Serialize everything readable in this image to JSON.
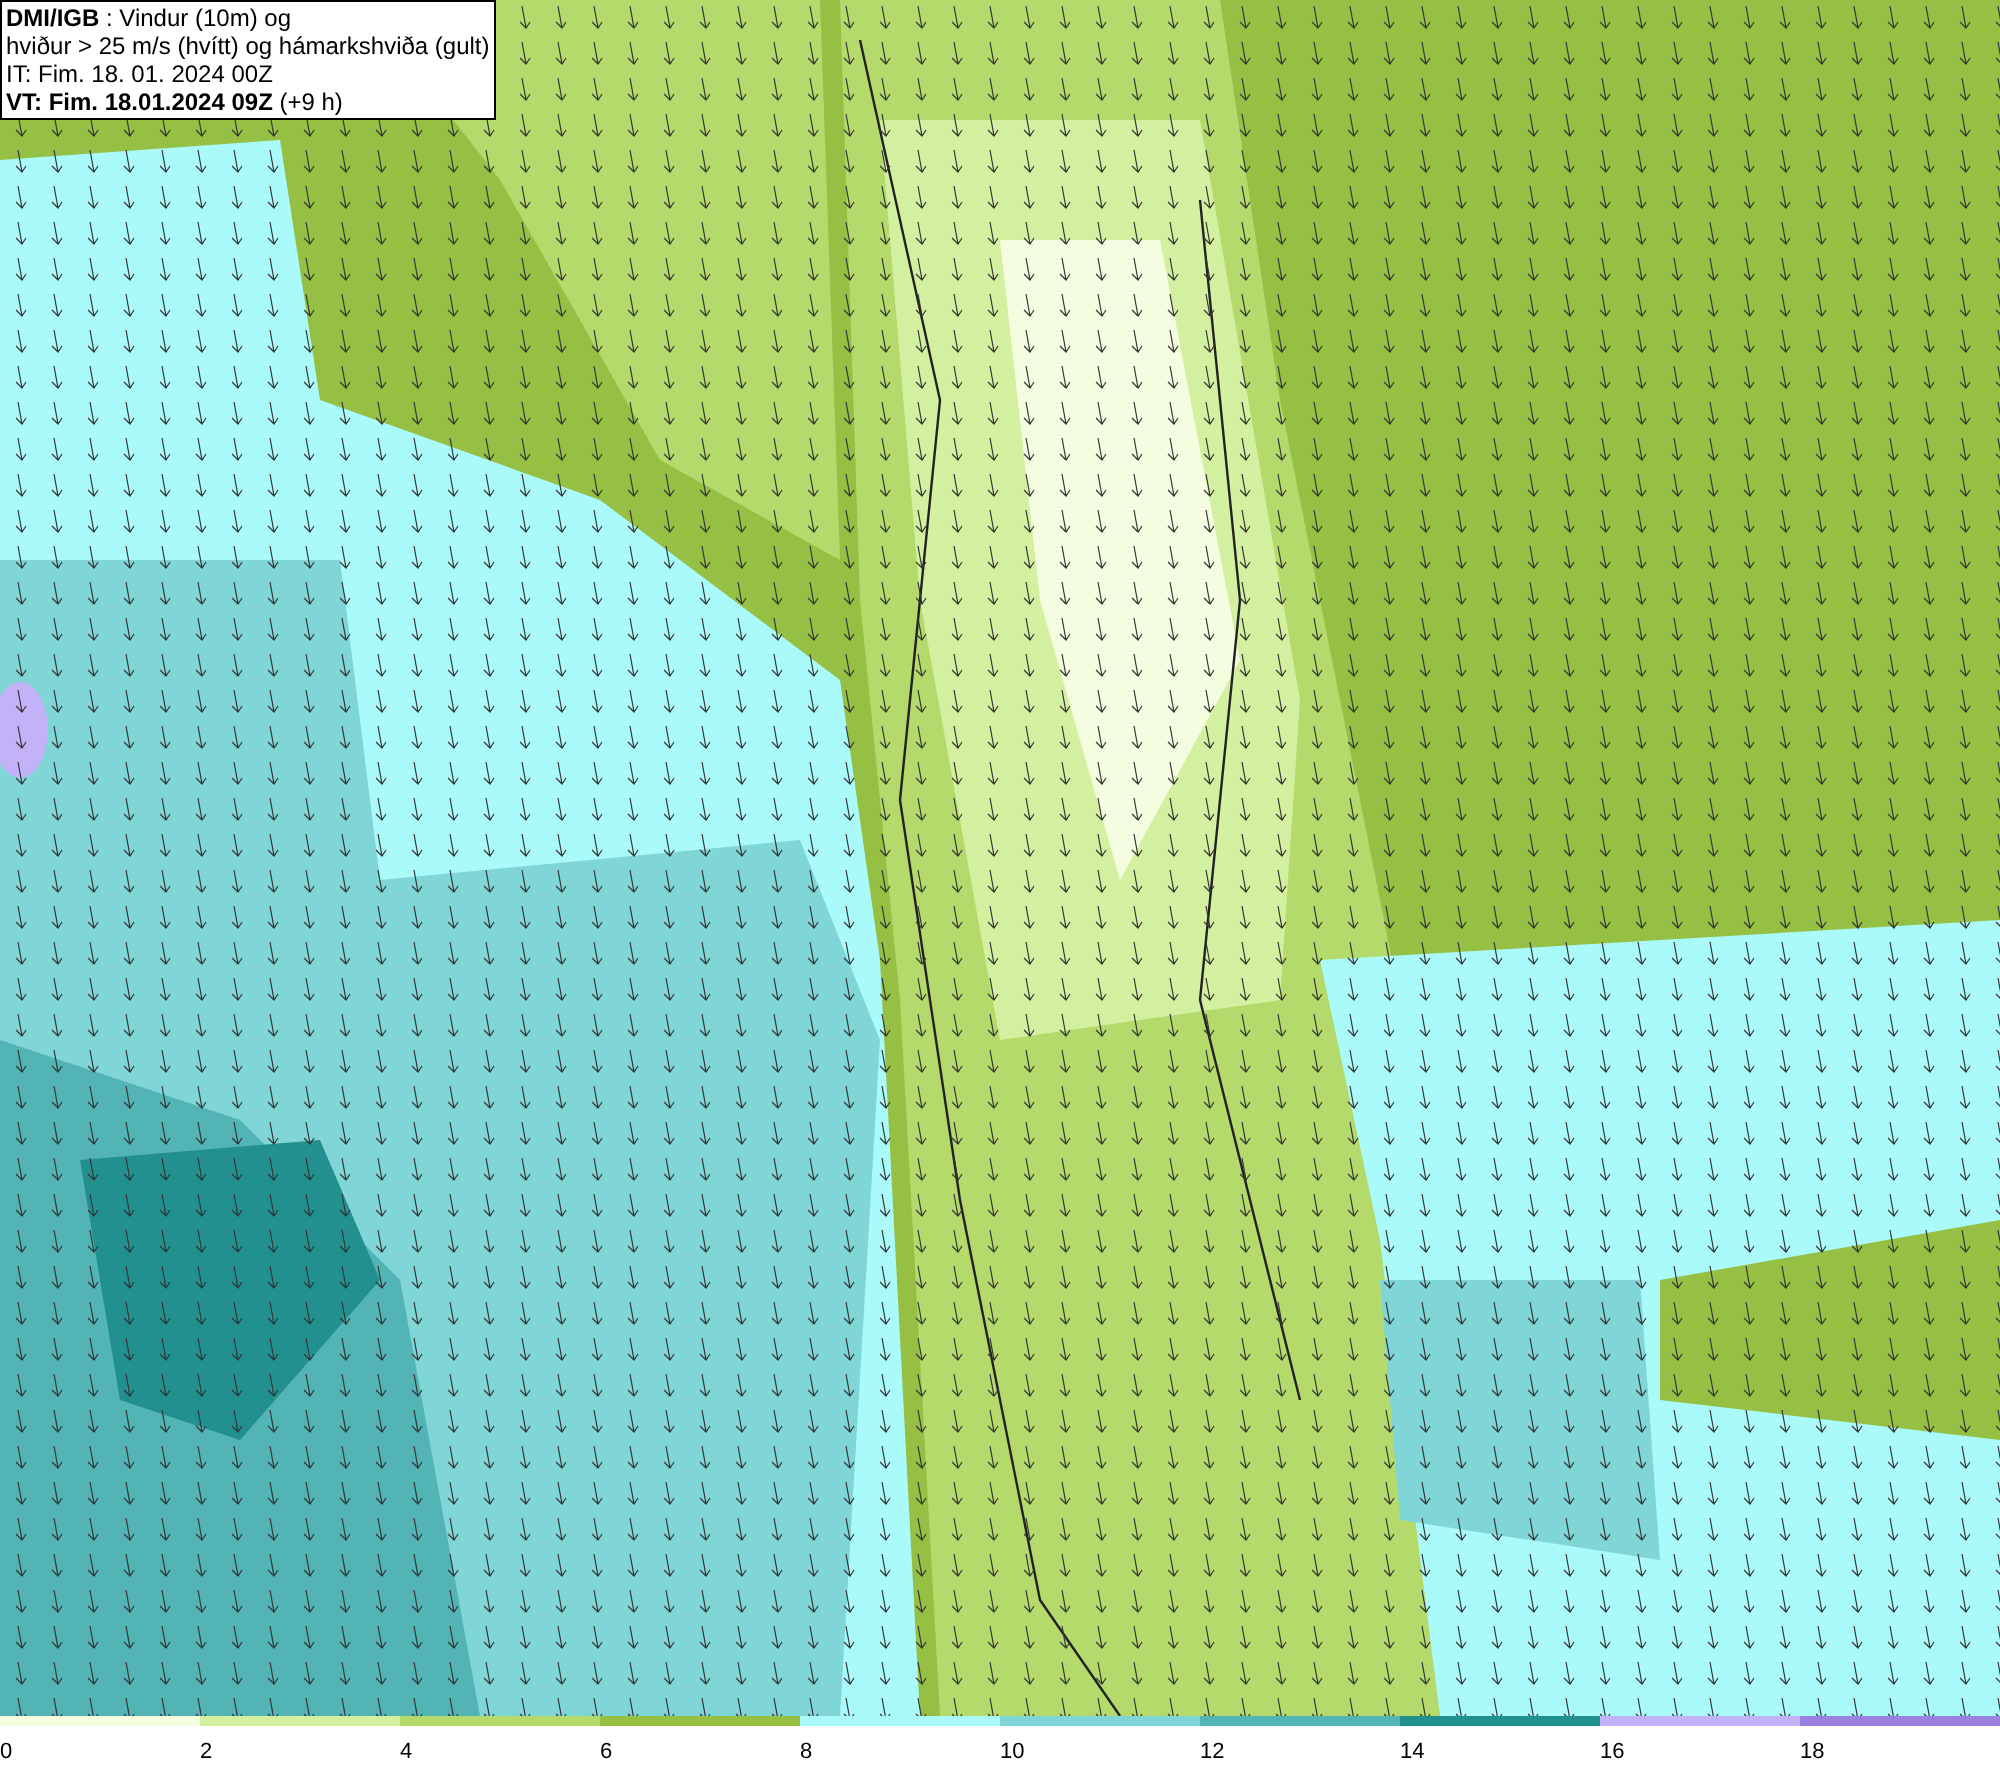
{
  "info_box": {
    "lines": [
      "**DMI/IGB** : Vindur (10m) og",
      "hviður > 25 m/s (hvítt) og hámarkshviða (gult)",
      "IT: Fim. 18. 01. 2024 00Z",
      "**VT: Fim. 18.01.2024 09Z** (+9 h)"
    ]
  },
  "legend": {
    "bins": [
      {
        "label": "0",
        "color": "#f5fde0"
      },
      {
        "label": "2",
        "color": "#d3f0a0"
      },
      {
        "label": "4",
        "color": "#b4da6c"
      },
      {
        "label": "6",
        "color": "#95c044"
      },
      {
        "label": "8",
        "color": "#aafafa"
      },
      {
        "label": "10",
        "color": "#80d6d6"
      },
      {
        "label": "12",
        "color": "#52b4b4"
      },
      {
        "label": "14",
        "color": "#239090"
      },
      {
        "label": "16",
        "color": "#c2b2f8"
      },
      {
        "label": "18",
        "color": "#9a80e0"
      }
    ]
  }
}
